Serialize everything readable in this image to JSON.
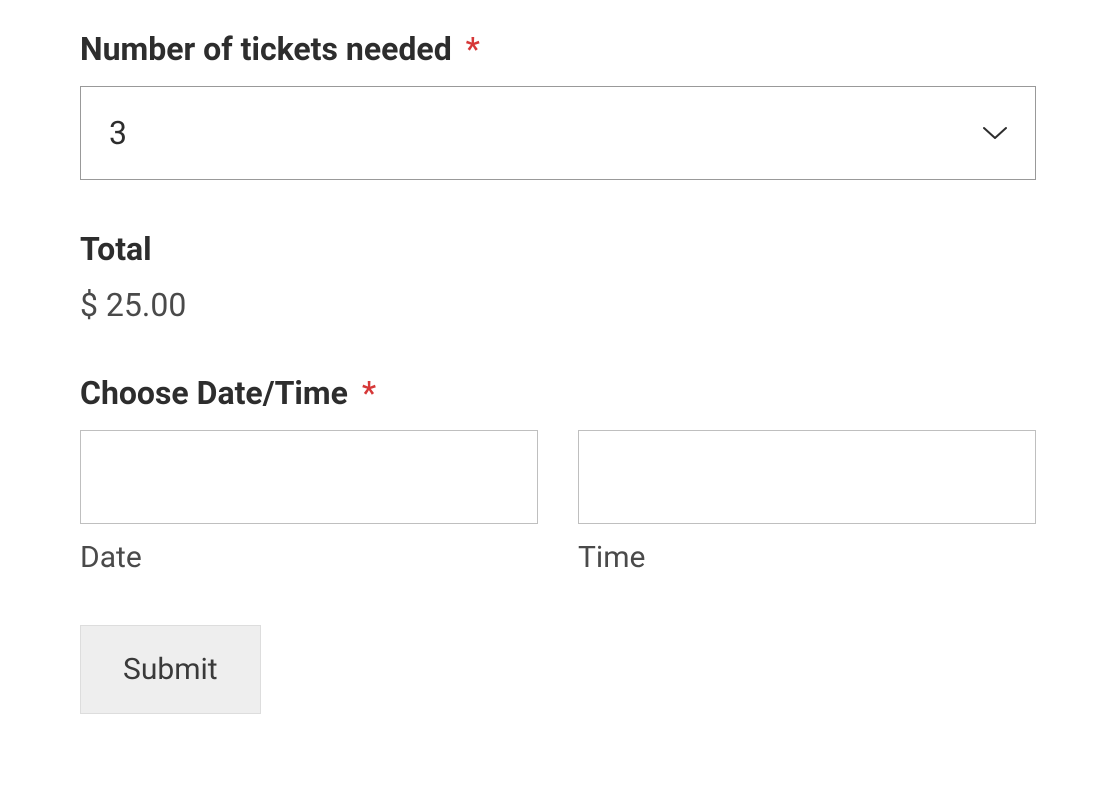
{
  "tickets": {
    "label": "Number of tickets needed",
    "value": "3"
  },
  "total": {
    "label": "Total",
    "value": "$ 25.00"
  },
  "datetime": {
    "label": "Choose Date/Time",
    "date_label": "Date",
    "time_label": "Time",
    "date_value": "",
    "time_value": ""
  },
  "submit_label": "Submit",
  "required_marker": "*"
}
